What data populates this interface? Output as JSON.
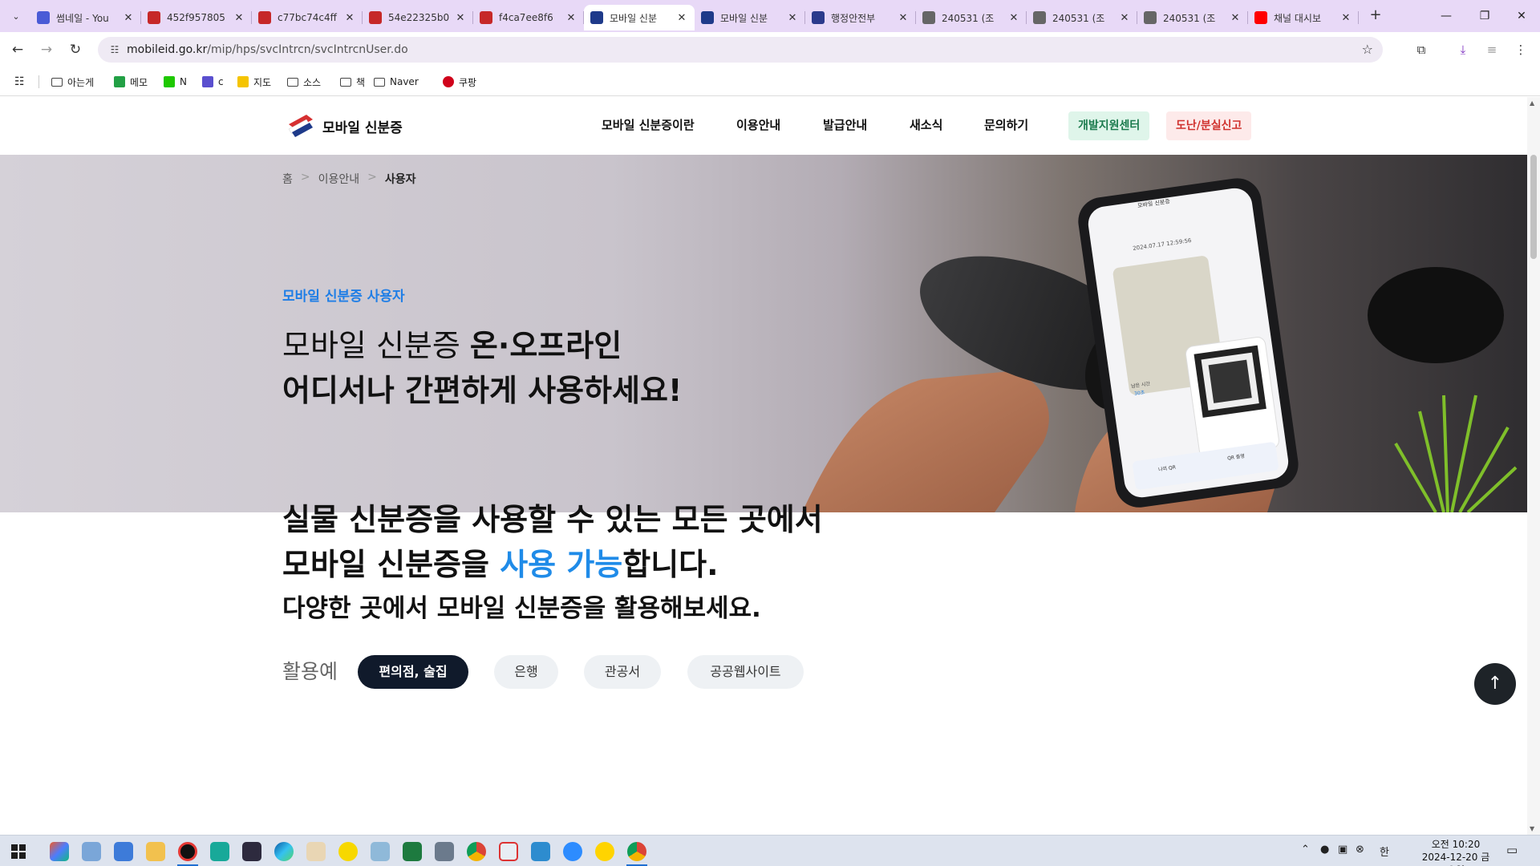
{
  "browser": {
    "tabs": [
      {
        "title": "썸네일 - You",
        "icon": "bookmark-app-icon",
        "color": "#4a5bd6"
      },
      {
        "title": "452f957805",
        "icon": "pdf-icon",
        "color": "#c62828"
      },
      {
        "title": "c77bc74c4ff",
        "icon": "pdf-icon",
        "color": "#c62828"
      },
      {
        "title": "54e22325b0",
        "icon": "pdf-icon",
        "color": "#c62828"
      },
      {
        "title": "f4ca7ee8f6",
        "icon": "pdf-icon",
        "color": "#c62828"
      },
      {
        "title": "모바일 신분",
        "icon": "mobile-id-icon",
        "color": "#1e3a8a",
        "active": true
      },
      {
        "title": "모바일 신분",
        "icon": "mobile-id-icon",
        "color": "#1e3a8a"
      },
      {
        "title": "행정안전부",
        "icon": "gov-icon",
        "color": "#2b3a8c"
      },
      {
        "title": "240531 (조",
        "icon": "globe-icon",
        "color": "#666666"
      },
      {
        "title": "240531 (조",
        "icon": "globe-icon",
        "color": "#666666"
      },
      {
        "title": "240531 (조",
        "icon": "globe-icon",
        "color": "#666666"
      },
      {
        "title": "채널 대시보",
        "icon": "youtube-icon",
        "color": "#ff0000"
      }
    ],
    "url_host": "mobileid.go.kr",
    "url_path": "/mip/hps/svcIntrcn/svcIntrcnUser.do",
    "bookmarks": [
      {
        "label": "아는게",
        "type": "folder"
      },
      {
        "label": "메모",
        "type": "memo",
        "color": "#22a045"
      },
      {
        "label": "N",
        "type": "naver",
        "color": "#1ec800"
      },
      {
        "label": "c",
        "type": "calendar",
        "color": "#5a4fcf"
      },
      {
        "label": "지도",
        "type": "map",
        "color": "#f5c400"
      },
      {
        "label": "소스",
        "type": "folder"
      },
      {
        "label": "책",
        "type": "folder"
      },
      {
        "label": "Naver",
        "type": "folder"
      },
      {
        "label": "쿠팡",
        "type": "coupang",
        "color": "#d0021b"
      }
    ]
  },
  "site": {
    "logo_text": "모바일 신분증",
    "nav": [
      "모바일 신분증이란",
      "이용안내",
      "발급안내",
      "새소식",
      "문의하기"
    ],
    "dev_center": "개발지원센터",
    "report": "도난/분실신고",
    "breadcrumb": [
      "홈",
      "이용안내",
      "사용자"
    ],
    "hero_sub": "모바일 신분증 사용자",
    "hero_line1_normal": "모바일 신분증 ",
    "hero_line1_bold": "온·오프라인",
    "hero_line2": "어디서나 간편하게 사용하세요!",
    "phone": {
      "app_title": "모바일 신분증",
      "timestamp": "2024.07.17 12:59:56",
      "remaining_label": "남은 시간",
      "remaining_value": "30초",
      "my_qr": "나의 QR",
      "qr_verify": "QR 증명"
    },
    "section_line1": "실물 신분증을 사용할 수 있는 모든 곳에서",
    "section_line2_a": "모바일 신분증을 ",
    "section_line2_hl": "사용 가능",
    "section_line2_b": "합니다.",
    "section_sub": "다양한 곳에서 모바일 신분증을 활용해보세요.",
    "use_label": "활용예",
    "chips": [
      "편의점, 술집",
      "은행",
      "관공서",
      "공공웹사이트"
    ],
    "colors": {
      "accent": "#1f8be8",
      "navy": "#101a2b",
      "dev_bg": "#dff5ea",
      "dev_fg": "#1a7a4c",
      "report_bg": "#fdeaea",
      "report_fg": "#d0312d"
    }
  },
  "taskbar": {
    "time": "오전 10:20",
    "date": "2024-12-20 금요일",
    "ime": "한"
  }
}
